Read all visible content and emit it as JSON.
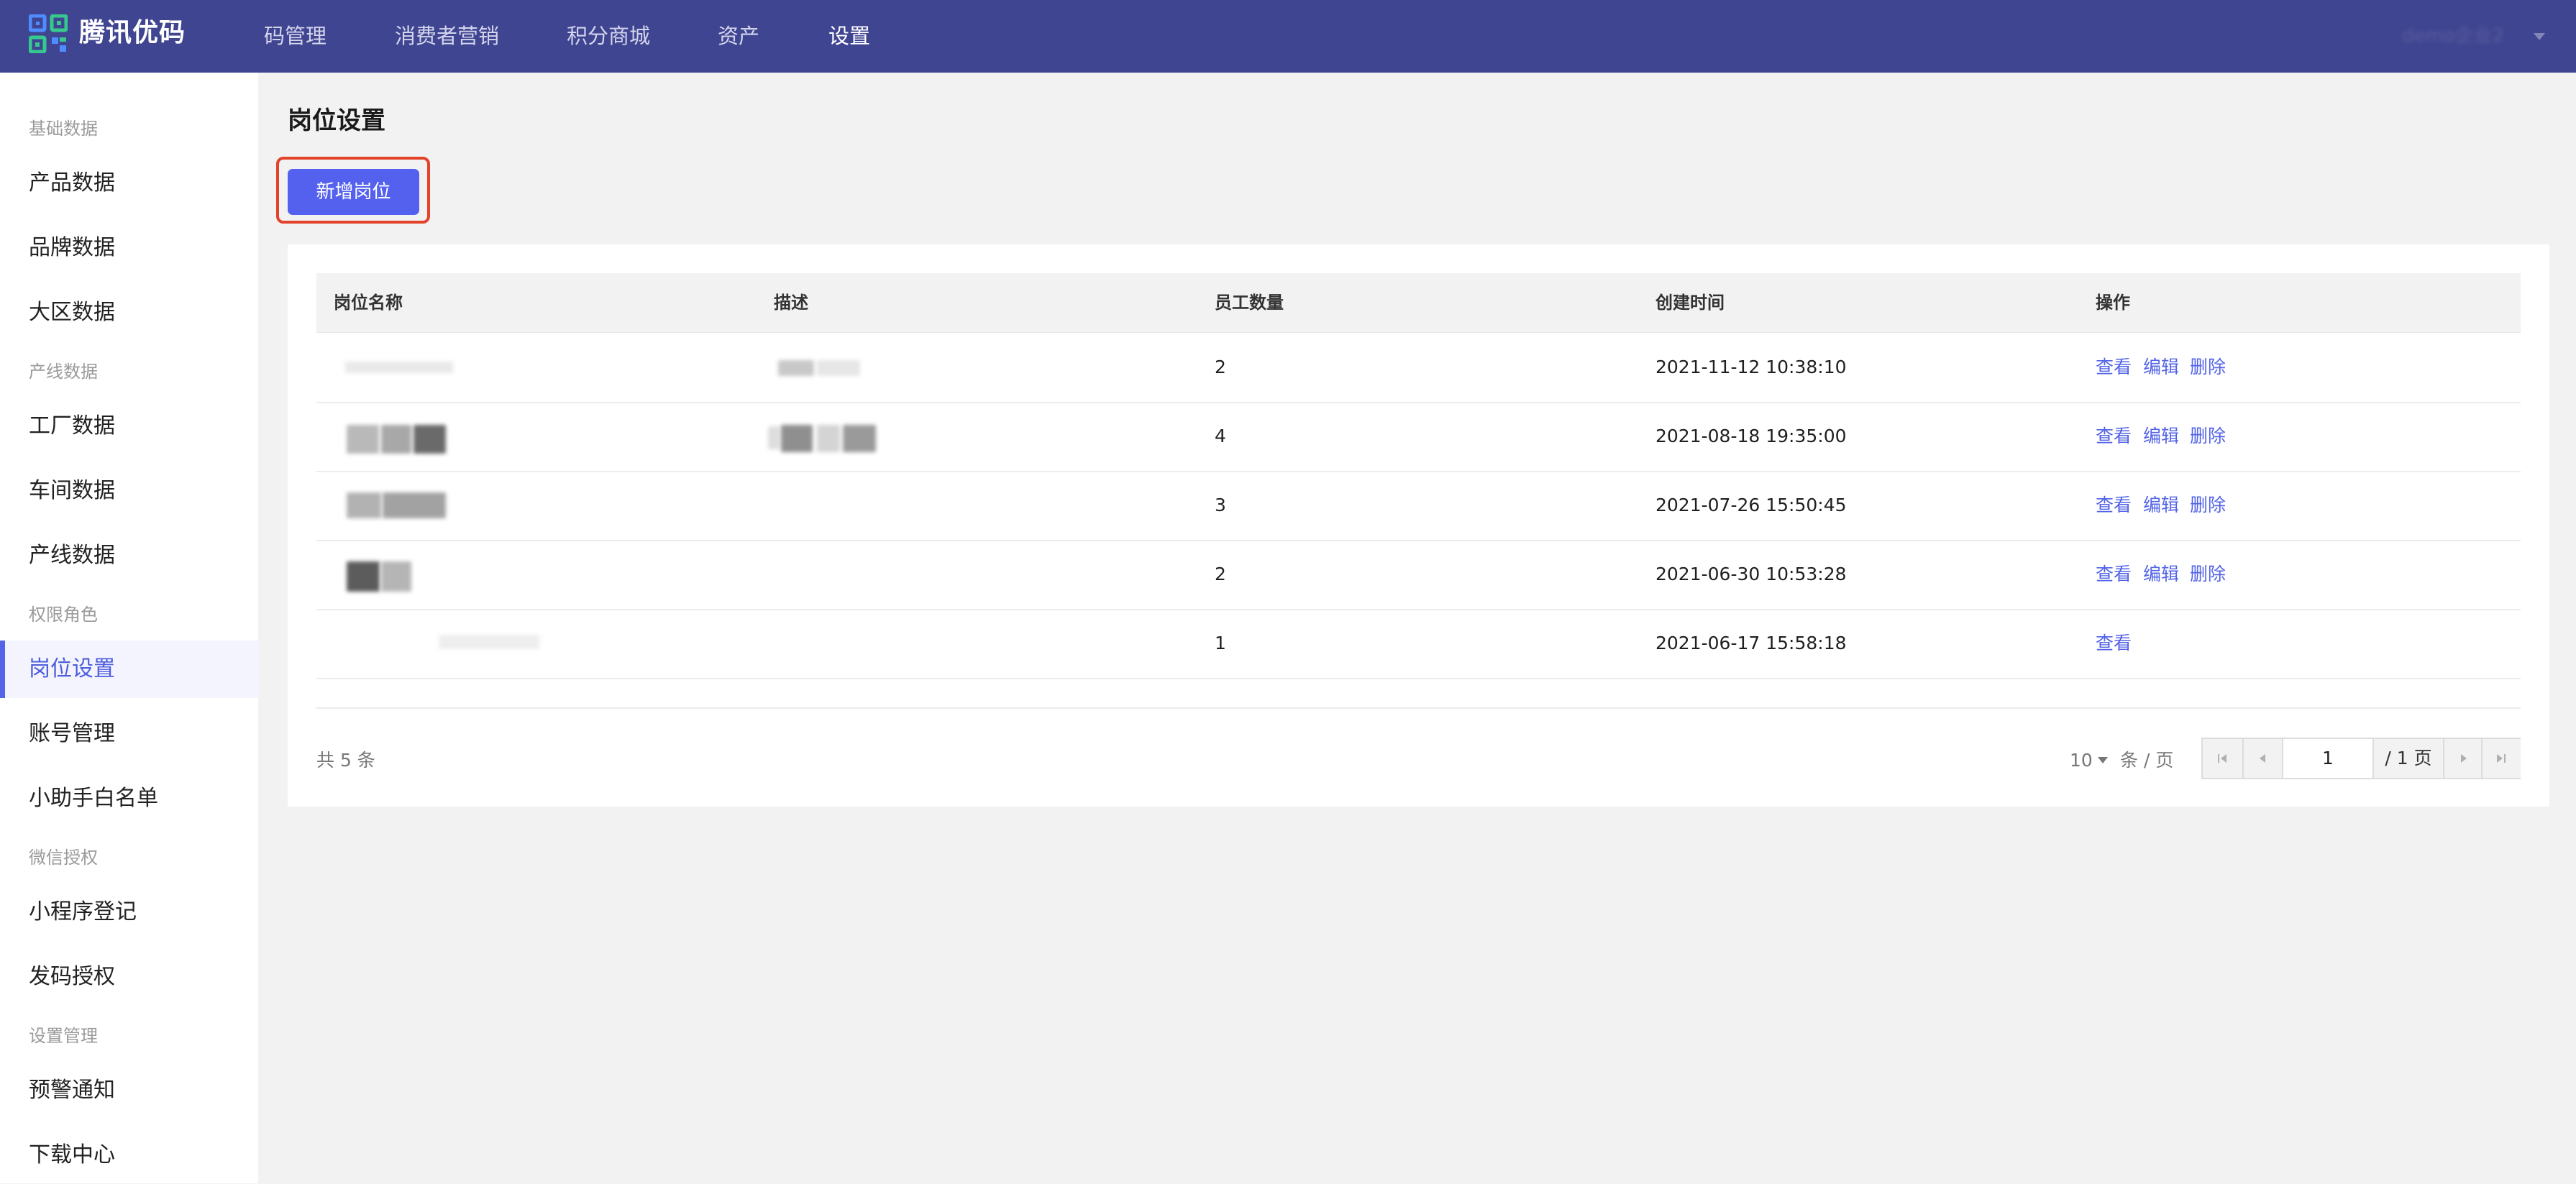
{
  "header": {
    "brand": "腾讯优码",
    "nav": [
      {
        "label": "码管理"
      },
      {
        "label": "消费者营销"
      },
      {
        "label": "积分商城"
      },
      {
        "label": "资产"
      },
      {
        "label": "设置"
      }
    ],
    "active_nav": "设置",
    "account_label": "demo企业2",
    "colors": {
      "bg": "#404591",
      "logo_blue": "#4e8cff",
      "logo_green": "#36c98e"
    }
  },
  "sidebar": {
    "groups": [
      {
        "title": "基础数据",
        "items": [
          "产品数据",
          "品牌数据",
          "大区数据"
        ]
      },
      {
        "title": "产线数据",
        "items": [
          "工厂数据",
          "车间数据",
          "产线数据"
        ]
      },
      {
        "title": "权限角色",
        "items": [
          "岗位设置",
          "账号管理",
          "小助手白名单"
        ]
      },
      {
        "title": "微信授权",
        "items": [
          "小程序登记",
          "发码授权"
        ]
      },
      {
        "title": "设置管理",
        "items": [
          "预警通知",
          "下载中心"
        ]
      }
    ],
    "active_item": "岗位设置",
    "accent": "#5563e7"
  },
  "main": {
    "title": "岗位设置",
    "add_button": "新增岗位",
    "table": {
      "columns": [
        "岗位名称",
        "描述",
        "员工数量",
        "创建时间",
        "操作"
      ],
      "rows": [
        {
          "name": "",
          "desc": "",
          "count": "2",
          "created": "2021-11-12 10:38:10",
          "actions": [
            "查看",
            "编辑",
            "删除"
          ]
        },
        {
          "name": "",
          "desc": "",
          "count": "4",
          "created": "2021-08-18 19:35:00",
          "actions": [
            "查看",
            "编辑",
            "删除"
          ]
        },
        {
          "name": "",
          "desc": "",
          "count": "3",
          "created": "2021-07-26 15:50:45",
          "actions": [
            "查看",
            "编辑",
            "删除"
          ]
        },
        {
          "name": "",
          "desc": "",
          "count": "2",
          "created": "2021-06-30 10:53:28",
          "actions": [
            "查看",
            "编辑",
            "删除"
          ]
        },
        {
          "name": "",
          "desc": "",
          "count": "1",
          "created": "2021-06-17 15:58:18",
          "actions": [
            "查看"
          ]
        }
      ]
    },
    "pagination": {
      "total_text": "共 5 条",
      "page_size": "10",
      "page_size_unit": "条 / 页",
      "current_page": "1",
      "total_pages_text": "/ 1 页"
    },
    "colors": {
      "primary": "#5461ee",
      "link": "#5263e6",
      "highlight": "#e2432a"
    }
  }
}
